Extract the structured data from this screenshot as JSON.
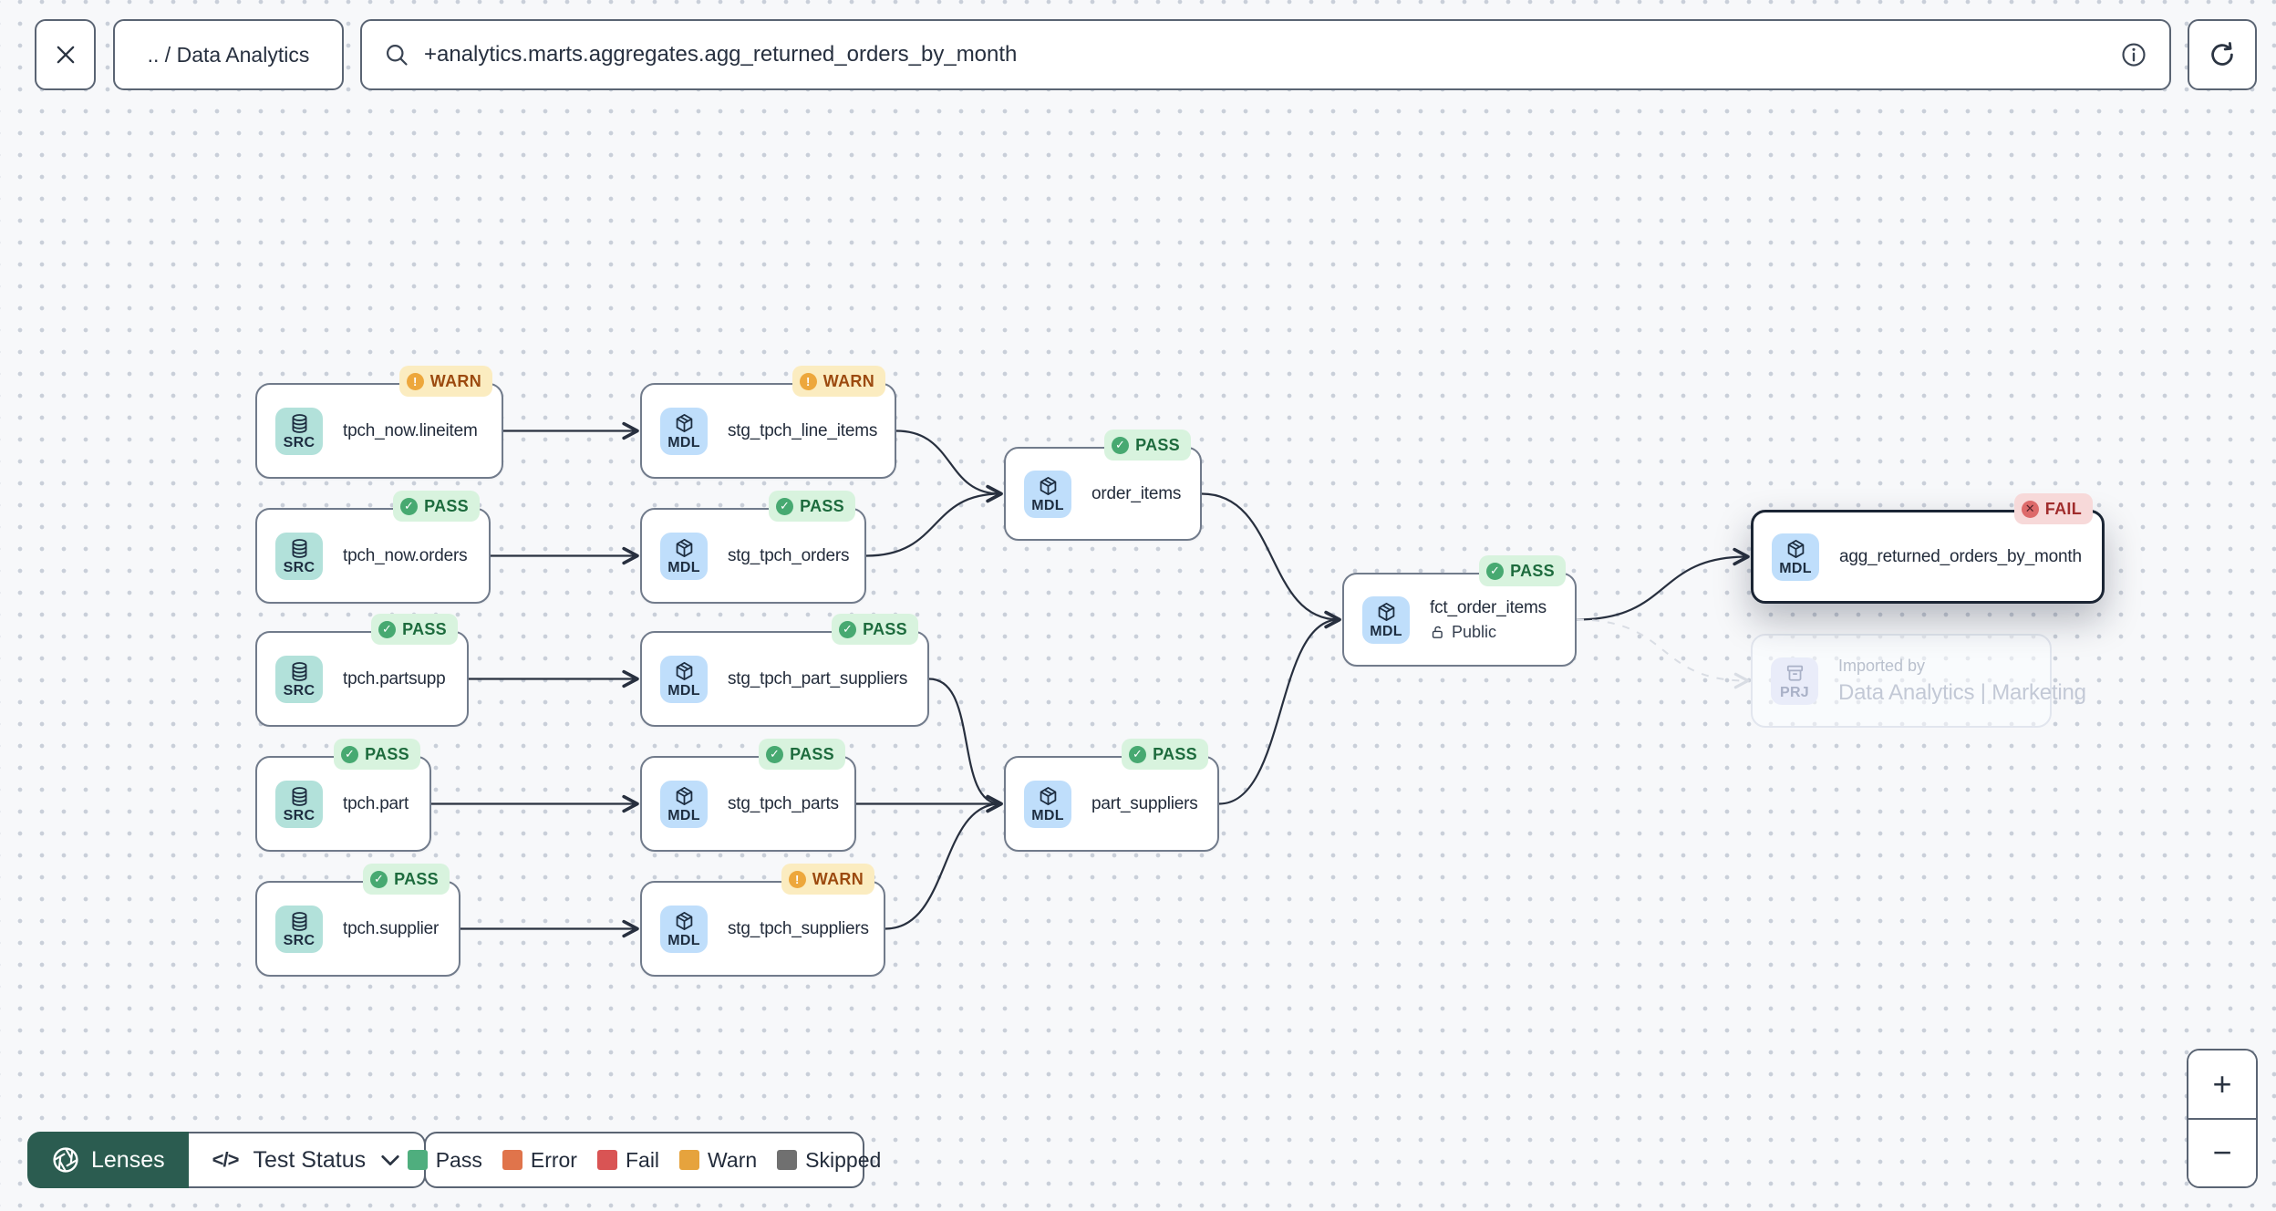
{
  "toolbar": {
    "breadcrumb": ".. / Data Analytics",
    "search": {
      "value": "+analytics.marts.aggregates.agg_returned_orders_by_month"
    }
  },
  "graph": {
    "nodes": [
      {
        "id": "tpch_now_lineitem",
        "label": "tpch_now.lineitem",
        "type": "SRC",
        "status": "WARN"
      },
      {
        "id": "stg_tpch_line_items",
        "label": "stg_tpch_line_items",
        "type": "MDL",
        "status": "WARN"
      },
      {
        "id": "tpch_now_orders",
        "label": "tpch_now.orders",
        "type": "SRC",
        "status": "PASS"
      },
      {
        "id": "stg_tpch_orders",
        "label": "stg_tpch_orders",
        "type": "MDL",
        "status": "PASS"
      },
      {
        "id": "order_items",
        "label": "order_items",
        "type": "MDL",
        "status": "PASS"
      },
      {
        "id": "tpch_partsupp",
        "label": "tpch.partsupp",
        "type": "SRC",
        "status": "PASS"
      },
      {
        "id": "stg_tpch_part_suppliers",
        "label": "stg_tpch_part_suppliers",
        "type": "MDL",
        "status": "PASS"
      },
      {
        "id": "fct_order_items",
        "label": "fct_order_items",
        "type": "MDL",
        "status": "PASS",
        "sublabel": "Public"
      },
      {
        "id": "agg_returned_orders_by_month",
        "label": "agg_returned_orders_by_month",
        "type": "MDL",
        "status": "FAIL",
        "selected": true
      },
      {
        "id": "imported_by_project",
        "label": "Data Analytics | Marketing",
        "type": "PRJ",
        "kicker": "Imported by",
        "ghost": true
      },
      {
        "id": "tpch_part",
        "label": "tpch.part",
        "type": "SRC",
        "status": "PASS"
      },
      {
        "id": "stg_tpch_parts",
        "label": "stg_tpch_parts",
        "type": "MDL",
        "status": "PASS"
      },
      {
        "id": "part_suppliers",
        "label": "part_suppliers",
        "type": "MDL",
        "status": "PASS"
      },
      {
        "id": "tpch_supplier",
        "label": "tpch.supplier",
        "type": "SRC",
        "status": "PASS"
      },
      {
        "id": "stg_tpch_suppliers",
        "label": "stg_tpch_suppliers",
        "type": "MDL",
        "status": "WARN"
      }
    ],
    "edges": [
      {
        "from": "tpch_now_lineitem",
        "to": "stg_tpch_line_items"
      },
      {
        "from": "tpch_now_orders",
        "to": "stg_tpch_orders"
      },
      {
        "from": "tpch_partsupp",
        "to": "stg_tpch_part_suppliers"
      },
      {
        "from": "tpch_part",
        "to": "stg_tpch_parts"
      },
      {
        "from": "tpch_supplier",
        "to": "stg_tpch_suppliers"
      },
      {
        "from": "stg_tpch_line_items",
        "to": "order_items"
      },
      {
        "from": "stg_tpch_orders",
        "to": "order_items"
      },
      {
        "from": "stg_tpch_part_suppliers",
        "to": "part_suppliers"
      },
      {
        "from": "stg_tpch_parts",
        "to": "part_suppliers"
      },
      {
        "from": "stg_tpch_suppliers",
        "to": "part_suppliers"
      },
      {
        "from": "order_items",
        "to": "fct_order_items"
      },
      {
        "from": "part_suppliers",
        "to": "fct_order_items"
      },
      {
        "from": "fct_order_items",
        "to": "agg_returned_orders_by_month"
      },
      {
        "from": "fct_order_items",
        "to": "imported_by_project",
        "ghost": true
      }
    ],
    "type_styles": {
      "SRC": {
        "bg": "#b2e1da"
      },
      "MDL": {
        "bg": "#bfdefb"
      },
      "PRJ": {
        "bg": "#e9ecf9"
      }
    },
    "status_styles": {
      "PASS": {
        "bg": "#d8f3de",
        "text": "#1d6b3d",
        "icon_bg": "#47a971",
        "glyph": "✓",
        "glyph_color": "#ffffff"
      },
      "WARN": {
        "bg": "#fbecc0",
        "text": "#9c4a0f",
        "icon_bg": "#eda73c",
        "glyph": "!",
        "glyph_color": "#ffffff"
      },
      "FAIL": {
        "bg": "#f7d9d9",
        "text": "#a02c2c",
        "icon_bg": "#dd6a6a",
        "glyph": "✕",
        "glyph_color": "#58252c"
      }
    }
  },
  "footer": {
    "lenses_label": "Lenses",
    "lens_selector_label": "Test Status",
    "code_glyph": "</>",
    "legend": [
      {
        "label": "Pass",
        "color": "#4fae7e"
      },
      {
        "label": "Error",
        "color": "#e0744b"
      },
      {
        "label": "Fail",
        "color": "#d95454"
      },
      {
        "label": "Warn",
        "color": "#e6a33d"
      },
      {
        "label": "Skipped",
        "color": "#707070"
      }
    ]
  },
  "zoom_controls": {
    "zoom_in": "+",
    "zoom_out": "−"
  }
}
